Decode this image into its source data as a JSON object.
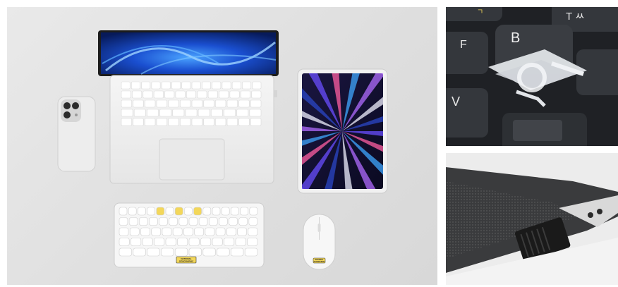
{
  "scene": {
    "left_panel": "main-product-flatlay",
    "right_top_panel": "keycap-scissor-switch-closeup",
    "right_bottom_panel": "usb-receiver-closeup"
  },
  "keyboard_badge": {
    "brand_line1": "NATIONAL",
    "brand_line2": "GEOGRAPHIC"
  },
  "mouse_badge": {
    "brand_line1": "NATIONAL",
    "brand_line2": "GEOGRAPHIC"
  },
  "closeup_keys": {
    "top_right_glyph": "T ㅆ",
    "top_left_glyph": "ㄱ",
    "center_key_letter": "B",
    "left_key_letter": "F",
    "bottom_left_letter": "V"
  },
  "colors": {
    "background": "#e2e2e2",
    "laptop_body": "#f2f2f2",
    "keyboard_accent": "#f3d75a",
    "dark_keyboard": "#2a2d31"
  }
}
